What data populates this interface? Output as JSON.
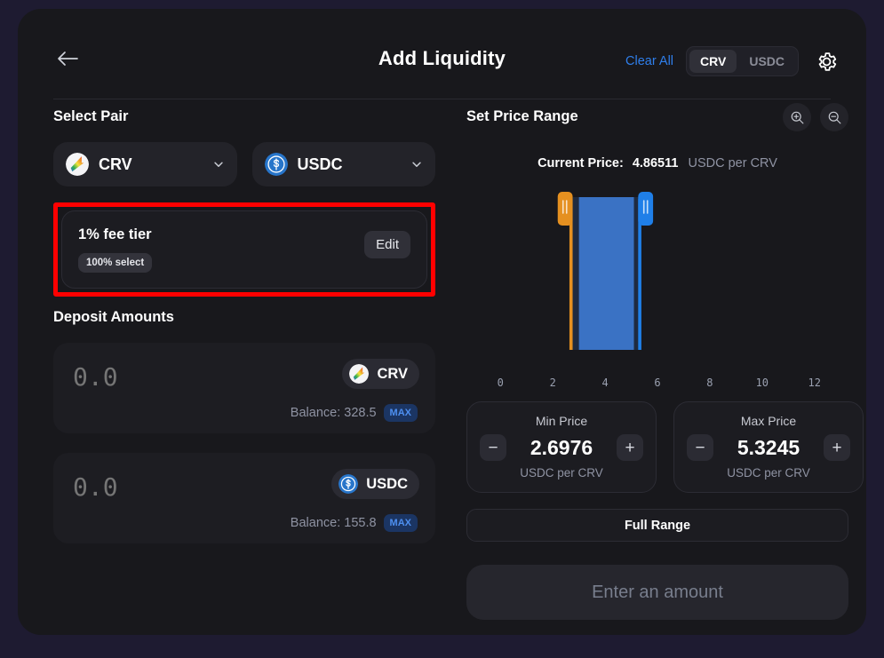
{
  "header": {
    "title": "Add Liquidity",
    "back_icon": "arrow-left-icon",
    "clear_all_label": "Clear All",
    "toggle_options": [
      "CRV",
      "USDC"
    ],
    "toggle_selected": "CRV",
    "settings_icon": "gear-icon"
  },
  "select_pair": {
    "title": "Select Pair",
    "tokens": [
      {
        "symbol": "CRV",
        "icon": "crv-token-icon"
      },
      {
        "symbol": "USDC",
        "icon": "usdc-token-icon"
      }
    ]
  },
  "fee_tier": {
    "title": "1% fee tier",
    "badge": "100% select",
    "edit_label": "Edit",
    "highlight_color": "#ff0000"
  },
  "deposit": {
    "title": "Deposit Amounts",
    "rows": [
      {
        "value": "",
        "placeholder": "0.0",
        "symbol": "CRV",
        "icon": "crv-token-icon",
        "balance_label": "Balance: 328.5",
        "max_label": "MAX"
      },
      {
        "value": "",
        "placeholder": "0.0",
        "symbol": "USDC",
        "icon": "usdc-token-icon",
        "balance_label": "Balance: 155.8",
        "max_label": "MAX"
      }
    ]
  },
  "price_range": {
    "title": "Set Price Range",
    "zoom_in_icon": "zoom-in-icon",
    "zoom_out_icon": "zoom-out-icon",
    "current_price_label": "Current Price:",
    "current_price_value": "4.86511",
    "current_price_unit": "USDC per CRV",
    "min": {
      "label": "Min Price",
      "value": "2.6976",
      "unit": "USDC per CRV",
      "decrement": "−",
      "increment": "+"
    },
    "max": {
      "label": "Max Price",
      "value": "5.3245",
      "unit": "USDC per CRV",
      "decrement": "−",
      "increment": "+"
    },
    "full_range_label": "Full Range",
    "submit_label": "Enter an amount"
  },
  "chart_data": {
    "type": "area",
    "title": "",
    "xlabel": "",
    "ylabel": "",
    "xlim": [
      -1.3,
      13.3
    ],
    "ticks": [
      0,
      2,
      4,
      6,
      8,
      10,
      12
    ],
    "tick_labels": [
      "0",
      "2",
      "4",
      "6",
      "8",
      "10",
      "12"
    ],
    "grid": false,
    "legend": "none",
    "selected_range": {
      "min": 2.6976,
      "max": 5.3245
    },
    "current_price": 4.86511,
    "handles": [
      {
        "name": "min-handle",
        "x": 2.6976,
        "color": "#e59020"
      },
      {
        "name": "max-handle",
        "x": 5.3245,
        "color": "#1f7fe8"
      }
    ],
    "series": [
      {
        "name": "liquidity-depth",
        "color": "#3a72c4",
        "bins": [
          {
            "x0": 3.0,
            "x1": 5.1,
            "value": 1.0
          }
        ]
      }
    ]
  }
}
